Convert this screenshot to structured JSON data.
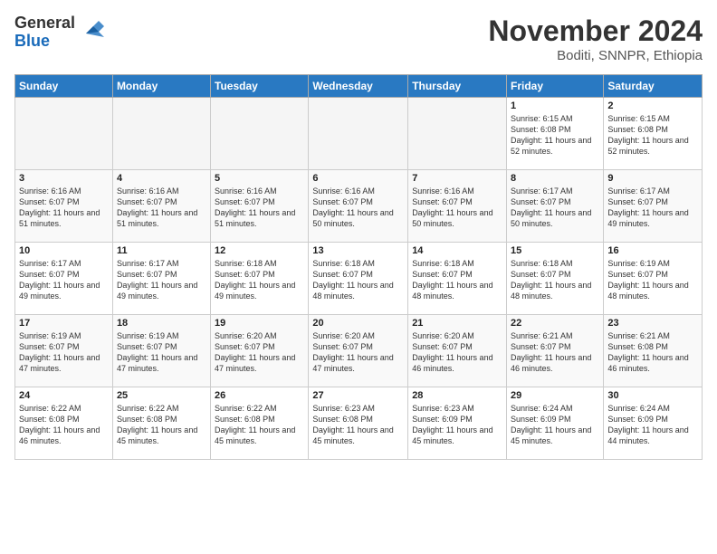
{
  "header": {
    "logo_general": "General",
    "logo_blue": "Blue",
    "month": "November 2024",
    "location": "Boditi, SNNPR, Ethiopia"
  },
  "days_of_week": [
    "Sunday",
    "Monday",
    "Tuesday",
    "Wednesday",
    "Thursday",
    "Friday",
    "Saturday"
  ],
  "weeks": [
    [
      {
        "day": "",
        "empty": true
      },
      {
        "day": "",
        "empty": true
      },
      {
        "day": "",
        "empty": true
      },
      {
        "day": "",
        "empty": true
      },
      {
        "day": "",
        "empty": true
      },
      {
        "day": "1",
        "sunrise": "6:15 AM",
        "sunset": "6:08 PM",
        "daylight": "11 hours and 52 minutes."
      },
      {
        "day": "2",
        "sunrise": "6:15 AM",
        "sunset": "6:08 PM",
        "daylight": "11 hours and 52 minutes."
      }
    ],
    [
      {
        "day": "3",
        "sunrise": "6:16 AM",
        "sunset": "6:07 PM",
        "daylight": "11 hours and 51 minutes."
      },
      {
        "day": "4",
        "sunrise": "6:16 AM",
        "sunset": "6:07 PM",
        "daylight": "11 hours and 51 minutes."
      },
      {
        "day": "5",
        "sunrise": "6:16 AM",
        "sunset": "6:07 PM",
        "daylight": "11 hours and 51 minutes."
      },
      {
        "day": "6",
        "sunrise": "6:16 AM",
        "sunset": "6:07 PM",
        "daylight": "11 hours and 50 minutes."
      },
      {
        "day": "7",
        "sunrise": "6:16 AM",
        "sunset": "6:07 PM",
        "daylight": "11 hours and 50 minutes."
      },
      {
        "day": "8",
        "sunrise": "6:17 AM",
        "sunset": "6:07 PM",
        "daylight": "11 hours and 50 minutes."
      },
      {
        "day": "9",
        "sunrise": "6:17 AM",
        "sunset": "6:07 PM",
        "daylight": "11 hours and 49 minutes."
      }
    ],
    [
      {
        "day": "10",
        "sunrise": "6:17 AM",
        "sunset": "6:07 PM",
        "daylight": "11 hours and 49 minutes."
      },
      {
        "day": "11",
        "sunrise": "6:17 AM",
        "sunset": "6:07 PM",
        "daylight": "11 hours and 49 minutes."
      },
      {
        "day": "12",
        "sunrise": "6:18 AM",
        "sunset": "6:07 PM",
        "daylight": "11 hours and 49 minutes."
      },
      {
        "day": "13",
        "sunrise": "6:18 AM",
        "sunset": "6:07 PM",
        "daylight": "11 hours and 48 minutes."
      },
      {
        "day": "14",
        "sunrise": "6:18 AM",
        "sunset": "6:07 PM",
        "daylight": "11 hours and 48 minutes."
      },
      {
        "day": "15",
        "sunrise": "6:18 AM",
        "sunset": "6:07 PM",
        "daylight": "11 hours and 48 minutes."
      },
      {
        "day": "16",
        "sunrise": "6:19 AM",
        "sunset": "6:07 PM",
        "daylight": "11 hours and 48 minutes."
      }
    ],
    [
      {
        "day": "17",
        "sunrise": "6:19 AM",
        "sunset": "6:07 PM",
        "daylight": "11 hours and 47 minutes."
      },
      {
        "day": "18",
        "sunrise": "6:19 AM",
        "sunset": "6:07 PM",
        "daylight": "11 hours and 47 minutes."
      },
      {
        "day": "19",
        "sunrise": "6:20 AM",
        "sunset": "6:07 PM",
        "daylight": "11 hours and 47 minutes."
      },
      {
        "day": "20",
        "sunrise": "6:20 AM",
        "sunset": "6:07 PM",
        "daylight": "11 hours and 47 minutes."
      },
      {
        "day": "21",
        "sunrise": "6:20 AM",
        "sunset": "6:07 PM",
        "daylight": "11 hours and 46 minutes."
      },
      {
        "day": "22",
        "sunrise": "6:21 AM",
        "sunset": "6:07 PM",
        "daylight": "11 hours and 46 minutes."
      },
      {
        "day": "23",
        "sunrise": "6:21 AM",
        "sunset": "6:08 PM",
        "daylight": "11 hours and 46 minutes."
      }
    ],
    [
      {
        "day": "24",
        "sunrise": "6:22 AM",
        "sunset": "6:08 PM",
        "daylight": "11 hours and 46 minutes."
      },
      {
        "day": "25",
        "sunrise": "6:22 AM",
        "sunset": "6:08 PM",
        "daylight": "11 hours and 45 minutes."
      },
      {
        "day": "26",
        "sunrise": "6:22 AM",
        "sunset": "6:08 PM",
        "daylight": "11 hours and 45 minutes."
      },
      {
        "day": "27",
        "sunrise": "6:23 AM",
        "sunset": "6:08 PM",
        "daylight": "11 hours and 45 minutes."
      },
      {
        "day": "28",
        "sunrise": "6:23 AM",
        "sunset": "6:09 PM",
        "daylight": "11 hours and 45 minutes."
      },
      {
        "day": "29",
        "sunrise": "6:24 AM",
        "sunset": "6:09 PM",
        "daylight": "11 hours and 45 minutes."
      },
      {
        "day": "30",
        "sunrise": "6:24 AM",
        "sunset": "6:09 PM",
        "daylight": "11 hours and 44 minutes."
      }
    ]
  ]
}
